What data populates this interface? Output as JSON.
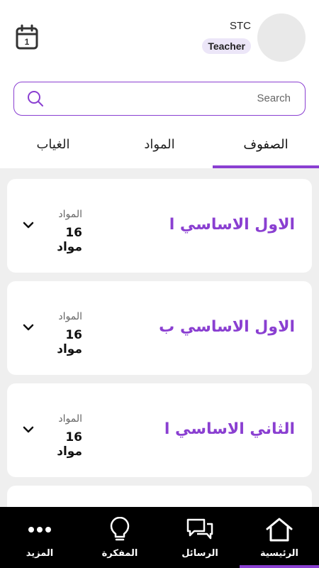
{
  "header": {
    "user_name": "STC",
    "role": "Teacher"
  },
  "search": {
    "placeholder": "Search"
  },
  "tabs": [
    {
      "label": "الصفوف",
      "active": true
    },
    {
      "label": "المواد",
      "active": false
    },
    {
      "label": "الغياب",
      "active": false
    }
  ],
  "classes": [
    {
      "title": "الاول الاساسي ا",
      "subjects_label": "المواد",
      "subjects_count": "16 مواد"
    },
    {
      "title": "الاول الاساسي ب",
      "subjects_label": "المواد",
      "subjects_count": "16 مواد"
    },
    {
      "title": "الثاني الاساسي ا",
      "subjects_label": "المواد",
      "subjects_count": "16 مواد"
    }
  ],
  "bottom_nav": [
    {
      "label": "الرئيسية",
      "icon": "home-icon",
      "active": true
    },
    {
      "label": "الرسائل",
      "icon": "chat-icon",
      "active": false
    },
    {
      "label": "المفكرة",
      "icon": "lightbulb-icon",
      "active": false
    },
    {
      "label": "المزيد",
      "icon": "more-icon",
      "active": false
    }
  ],
  "colors": {
    "accent": "#8a3fd1",
    "nav_background": "#000000",
    "badge_background": "#ece6f8"
  }
}
